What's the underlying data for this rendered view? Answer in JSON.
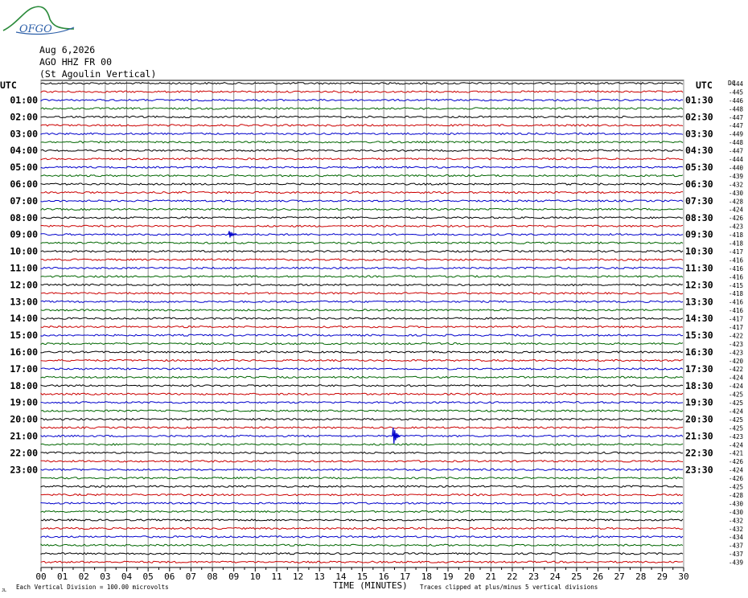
{
  "logo": {
    "text": "OFGO"
  },
  "header": {
    "date": "Aug 6,2026",
    "station": "AGO HHZ FR 00",
    "location": "(St Agoulin Vertical)"
  },
  "footer": {
    "scale": "Each Vertical Division =  100.00 microvolts",
    "xlabel": "TIME (MINUTES)",
    "clip_note": "Traces clipped at plus/minus 5 vertical divisions",
    "corner_mark": "JL"
  },
  "chart_data": {
    "type": "line",
    "title": "",
    "xlabel": "TIME (MINUTES)",
    "ylabel": "UTC",
    "right_ylabel": "UTC",
    "dc_label": "DC",
    "xlim": [
      0,
      30
    ],
    "x_ticks": [
      "00",
      "01",
      "02",
      "03",
      "04",
      "05",
      "06",
      "07",
      "08",
      "09",
      "10",
      "11",
      "12",
      "13",
      "14",
      "15",
      "16",
      "17",
      "18",
      "19",
      "20",
      "21",
      "22",
      "23",
      "24",
      "25",
      "26",
      "27",
      "28",
      "29",
      "30"
    ],
    "line_colors": [
      "#000000",
      "#cc0000",
      "#0000cc",
      "#006600"
    ],
    "grid": true,
    "left_labels": [
      "01:00",
      "02:00",
      "03:00",
      "04:00",
      "05:00",
      "06:00",
      "07:00",
      "08:00",
      "09:00",
      "10:00",
      "11:00",
      "12:00",
      "13:00",
      "14:00",
      "15:00",
      "16:00",
      "17:00",
      "18:00",
      "19:00",
      "20:00",
      "21:00",
      "22:00",
      "23:00"
    ],
    "right_labels": [
      "01:30",
      "02:30",
      "03:30",
      "04:30",
      "05:30",
      "06:30",
      "07:30",
      "08:30",
      "09:30",
      "10:30",
      "11:30",
      "12:30",
      "13:30",
      "14:30",
      "15:30",
      "16:30",
      "17:30",
      "18:30",
      "19:30",
      "20:30",
      "21:30",
      "22:30",
      "23:30"
    ],
    "dc_offsets": [
      444,
      445,
      446,
      448,
      447,
      447,
      449,
      448,
      447,
      444,
      440,
      439,
      432,
      430,
      428,
      424,
      426,
      423,
      418,
      418,
      417,
      416,
      416,
      416,
      415,
      418,
      416,
      416,
      417,
      417,
      422,
      423,
      423,
      420,
      422,
      424,
      424,
      425,
      425,
      424,
      425,
      425,
      423,
      424,
      421,
      426,
      424,
      426,
      425,
      428,
      430,
      430,
      432,
      432,
      434,
      437,
      437,
      439
    ],
    "events": [
      {
        "label": "09:00",
        "minute": 8.75,
        "amplitude_divisions": 0.4
      },
      {
        "label": "21:00",
        "minute": 16.4,
        "amplitude_divisions": 1.0
      }
    ]
  }
}
